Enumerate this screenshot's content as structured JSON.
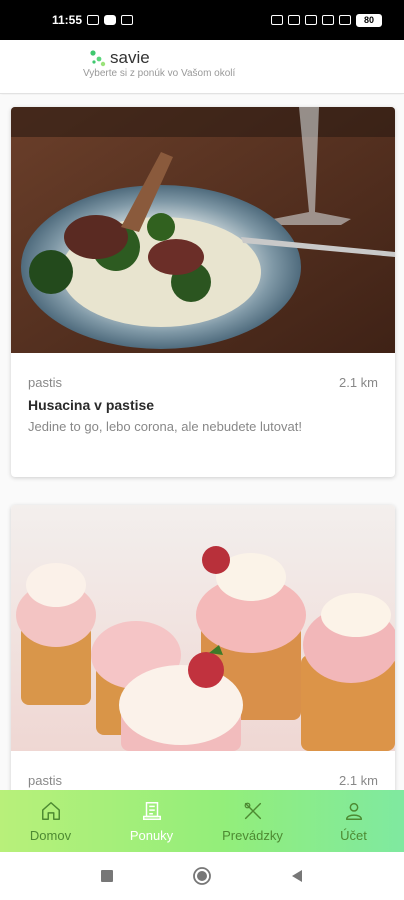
{
  "status_bar": {
    "time": "11:55",
    "battery": "80"
  },
  "header": {
    "brand": "savie",
    "tagline": "Vyberte si z ponúk vo Vašom okolí"
  },
  "cards": [
    {
      "category": "pastis",
      "distance": "2.1 km",
      "title": "Husacina v pastise",
      "description": "Jedine to go, lebo corona, ale nebudete lutovat!"
    },
    {
      "category": "pastis",
      "distance": "2.1 km"
    }
  ],
  "nav": {
    "items": [
      {
        "label": "Domov",
        "icon": "home-icon"
      },
      {
        "label": "Ponuky",
        "icon": "offers-icon",
        "active": true
      },
      {
        "label": "Prevádzky",
        "icon": "restaurants-icon"
      },
      {
        "label": "Účet",
        "icon": "account-icon"
      }
    ]
  },
  "colors": {
    "nav_gradient_start": "#b8f07a",
    "nav_gradient_end": "#7fe9a0",
    "brand_accent": "#3fc86f"
  }
}
